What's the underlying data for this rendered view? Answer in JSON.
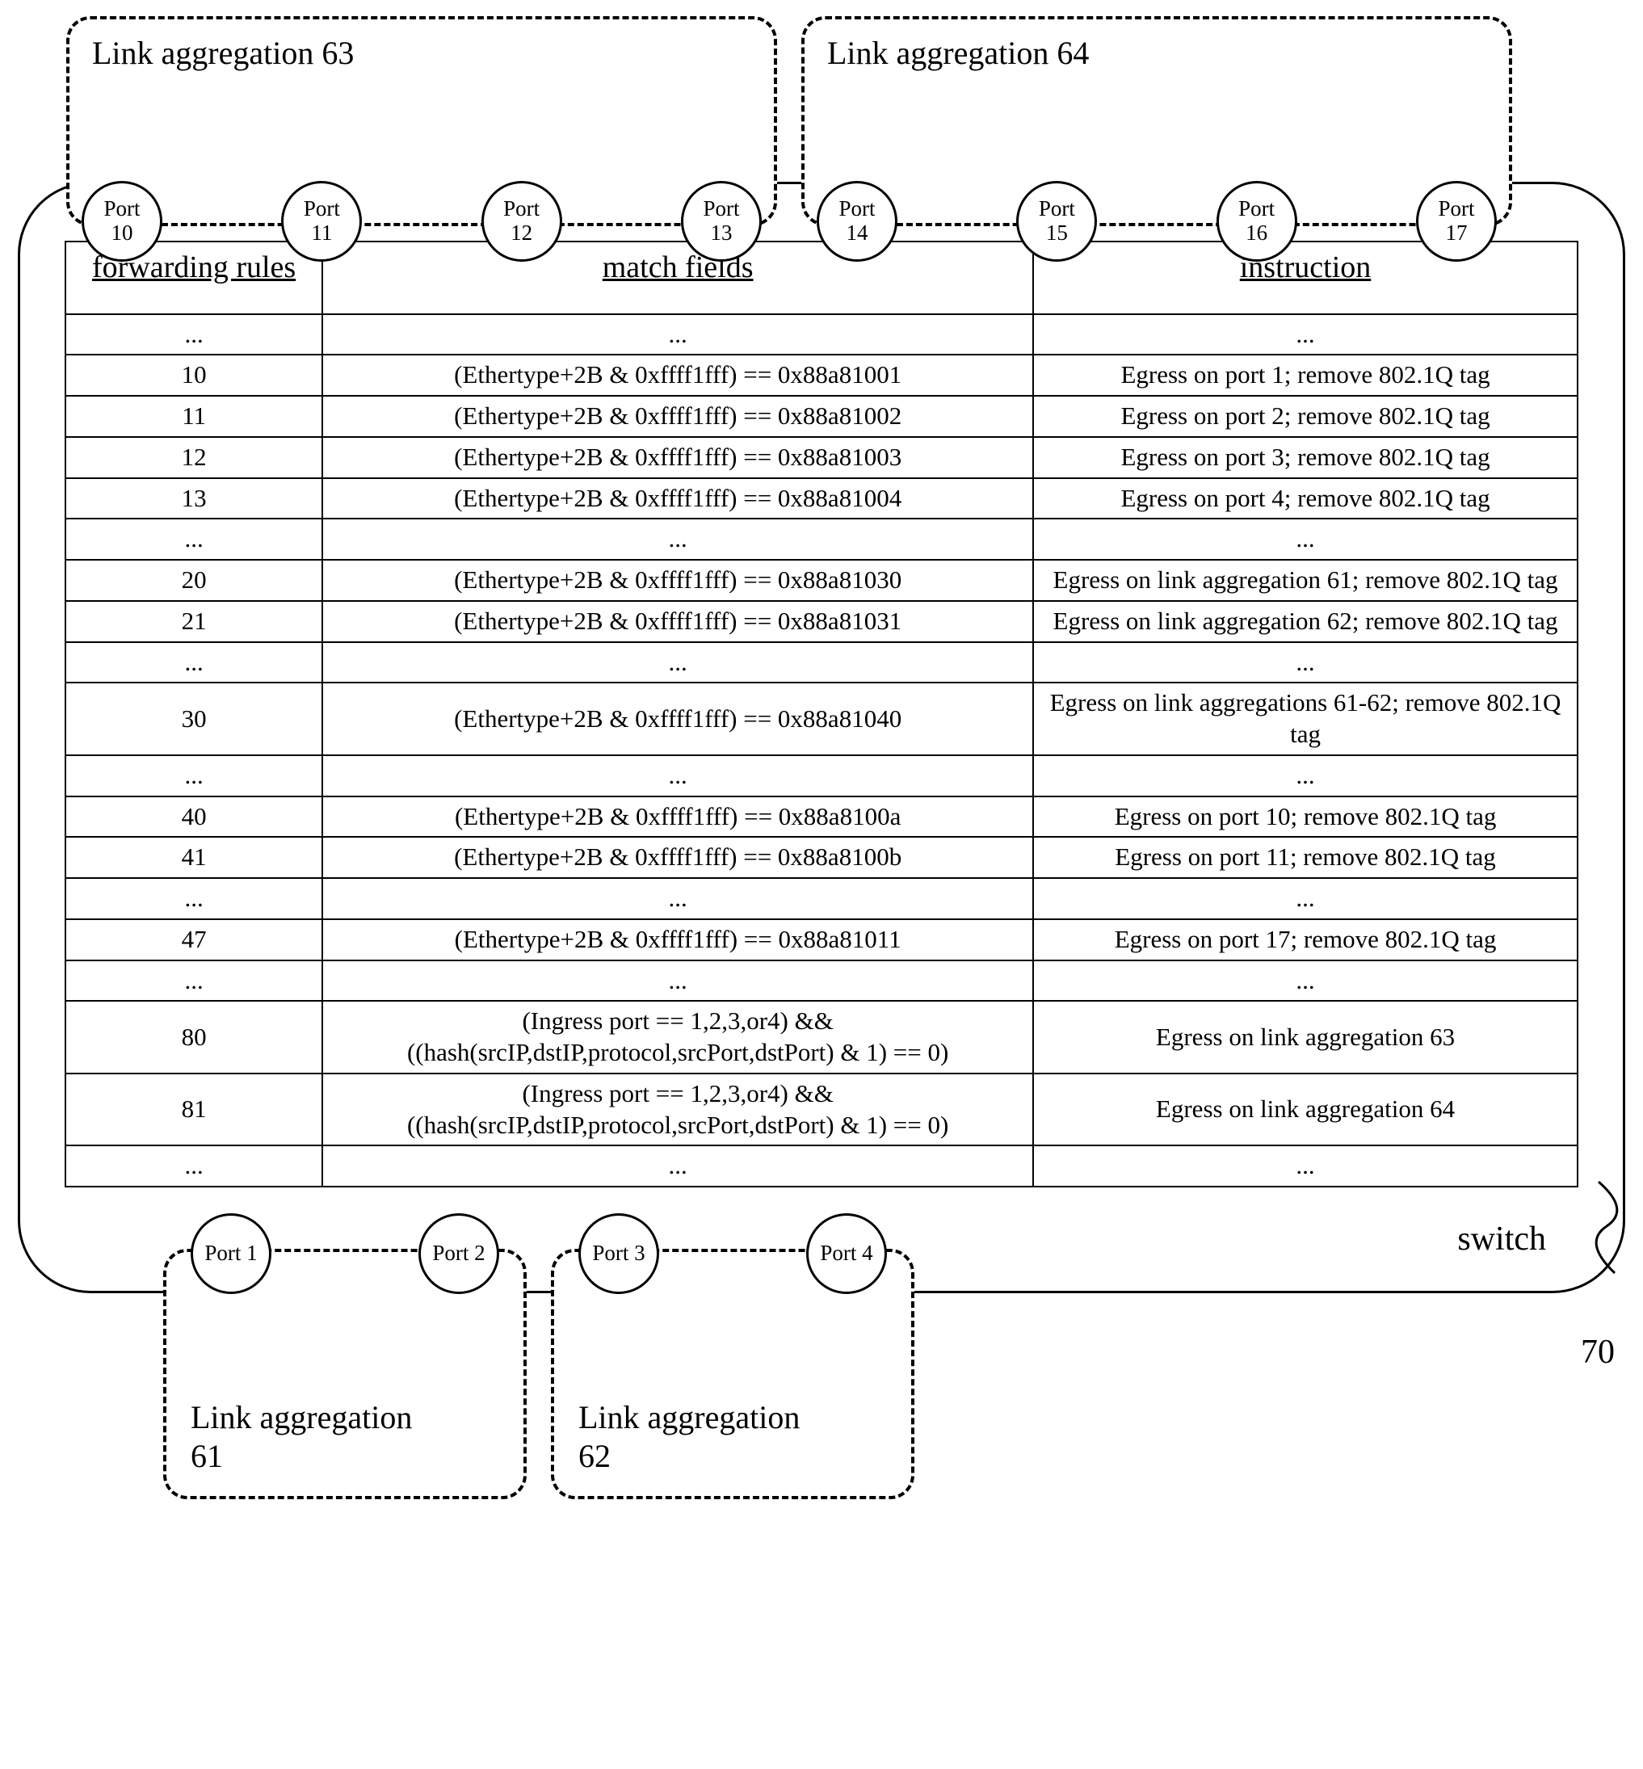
{
  "topAggs": [
    {
      "title": "Link aggregation 63",
      "ports": [
        {
          "line1": "Port",
          "line2": "10"
        },
        {
          "line1": "Port",
          "line2": "11"
        },
        {
          "line1": "Port",
          "line2": "12"
        },
        {
          "line1": "Port",
          "line2": "13"
        }
      ]
    },
    {
      "title": "Link aggregation 64",
      "ports": [
        {
          "line1": "Port",
          "line2": "14"
        },
        {
          "line1": "Port",
          "line2": "15"
        },
        {
          "line1": "Port",
          "line2": "16"
        },
        {
          "line1": "Port",
          "line2": "17"
        }
      ]
    }
  ],
  "bottomAggs": [
    {
      "title": "Link aggregation\n61",
      "ports": [
        {
          "line1": "Port 1",
          "line2": ""
        },
        {
          "line1": "Port 2",
          "line2": ""
        }
      ]
    },
    {
      "title": "Link aggregation\n62",
      "ports": [
        {
          "line1": "Port 3",
          "line2": ""
        },
        {
          "line1": "Port 4",
          "line2": ""
        }
      ]
    }
  ],
  "table": {
    "headers": [
      "forwarding rules",
      "match fields",
      "instruction"
    ],
    "rows": [
      {
        "rule": "...",
        "match": "...",
        "instr": "..."
      },
      {
        "rule": "10",
        "match": "(Ethertype+2B & 0xffff1fff) == 0x88a81001",
        "instr": "Egress on port 1; remove 802.1Q tag"
      },
      {
        "rule": "11",
        "match": "(Ethertype+2B & 0xffff1fff) == 0x88a81002",
        "instr": "Egress on port 2; remove 802.1Q tag"
      },
      {
        "rule": "12",
        "match": "(Ethertype+2B & 0xffff1fff) == 0x88a81003",
        "instr": "Egress on port 3; remove 802.1Q tag"
      },
      {
        "rule": "13",
        "match": "(Ethertype+2B & 0xffff1fff) == 0x88a81004",
        "instr": "Egress on port 4; remove 802.1Q tag"
      },
      {
        "rule": "...",
        "match": "...",
        "instr": "..."
      },
      {
        "rule": "20",
        "match": "(Ethertype+2B & 0xffff1fff) == 0x88a81030",
        "instr": "Egress on link aggregation 61; remove 802.1Q tag"
      },
      {
        "rule": "21",
        "match": "(Ethertype+2B & 0xffff1fff) == 0x88a81031",
        "instr": "Egress on link aggregation 62; remove 802.1Q tag"
      },
      {
        "rule": "...",
        "match": "...",
        "instr": "..."
      },
      {
        "rule": "30",
        "match": "(Ethertype+2B & 0xffff1fff) == 0x88a81040",
        "instr": "Egress on link aggregations 61-62; remove 802.1Q tag"
      },
      {
        "rule": "...",
        "match": "...",
        "instr": "..."
      },
      {
        "rule": "40",
        "match": "(Ethertype+2B & 0xffff1fff) == 0x88a8100a",
        "instr": "Egress on port 10; remove 802.1Q tag"
      },
      {
        "rule": "41",
        "match": "(Ethertype+2B & 0xffff1fff) == 0x88a8100b",
        "instr": "Egress on port 11; remove 802.1Q tag"
      },
      {
        "rule": "...",
        "match": "...",
        "instr": "..."
      },
      {
        "rule": "47",
        "match": "(Ethertype+2B & 0xffff1fff) == 0x88a81011",
        "instr": "Egress on port 17; remove 802.1Q tag"
      },
      {
        "rule": "...",
        "match": "...",
        "instr": "..."
      },
      {
        "rule": "80",
        "match": "(Ingress port == 1,2,3,or4) && ((hash(srcIP,dstIP,protocol,srcPort,dstPort) & 1) == 0)",
        "instr": "Egress on link aggregation 63"
      },
      {
        "rule": "81",
        "match": "(Ingress port == 1,2,3,or4) && ((hash(srcIP,dstIP,protocol,srcPort,dstPort) & 1) == 0)",
        "instr": "Egress on link aggregation 64"
      },
      {
        "rule": "...",
        "match": "...",
        "instr": "..."
      }
    ]
  },
  "switchLabel": "switch",
  "referenceNum": "70"
}
